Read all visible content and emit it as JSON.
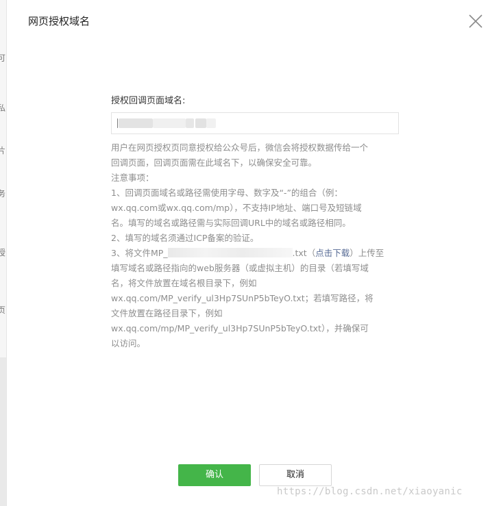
{
  "background": {
    "fragments": [
      "可",
      "私",
      "片",
      "务",
      "授",
      "页"
    ]
  },
  "dialog": {
    "title": "网页授权域名",
    "field_label": "授权回调页面域名:",
    "field_value": "",
    "desc_lines": [
      "用户在网页授权页同意授权给公众号后，微信会将授权数据传给一个",
      "回调页面，回调页面需在此域名下，以确保安全可靠。",
      "注意事项：",
      "1、回调页面域名或路径需使用字母、数字及“-”的组合（例：",
      "wx.qq.com或wx.qq.com/mp），不支持IP地址、端口号及短链域",
      "名。填写的域名或路径需与实际回调URL中的域名或路径相同。",
      "2、填写的域名须通过ICP备案的验证。"
    ],
    "item3_prefix": "3、将文件MP_",
    "item3_ext": ".txt（",
    "item3_link": "点击下载",
    "item3_suffix": "）上传至",
    "desc_tail": [
      "填写域名或路径指向的web服务器（或虚拟主机）的目录（若填写域",
      "名，将文件放置在域名根目录下，例如",
      "wx.qq.com/MP_verify_ul3Hp7SUnP5bTeyO.txt；若填写路径，将",
      "文件放置在路径目录下，例如",
      "wx.qq.com/mp/MP_verify_ul3Hp7SUnP5bTeyO.txt），并确保可",
      "以访问。"
    ],
    "confirm_label": "确认",
    "cancel_label": "取消"
  },
  "watermark": "https://blog.csdn.net/xiaoyanic",
  "colors": {
    "primary": "#44b549",
    "link": "#576b95",
    "muted_text": "#8d8d8d"
  }
}
